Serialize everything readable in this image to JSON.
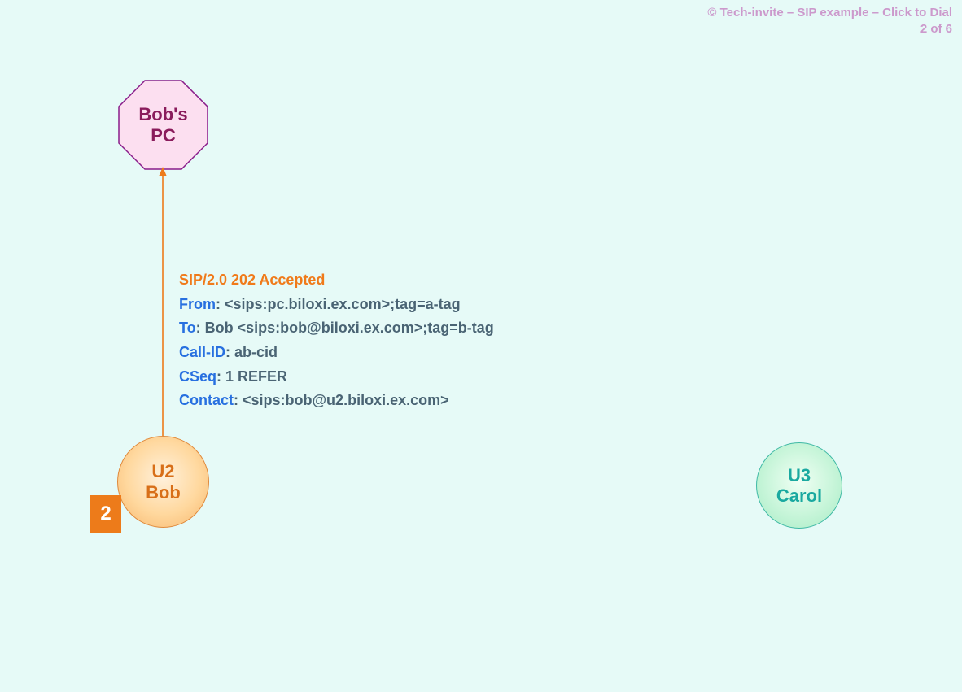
{
  "header": {
    "copyright": "© Tech-invite – SIP example – Click to Dial",
    "page_indicator": "2 of 6"
  },
  "nodes": {
    "pc": {
      "label": "Bob's\nPC"
    },
    "bob": {
      "label": "U2\nBob"
    },
    "carol": {
      "label": "U3\nCarol"
    }
  },
  "step": {
    "number": "2"
  },
  "message": {
    "status_line": "SIP/2.0 202 Accepted",
    "headers": {
      "from": {
        "name": "From",
        "value": " <sips:pc.biloxi.ex.com>;tag=a-tag"
      },
      "to": {
        "name": "To",
        "value": " Bob <sips:bob@biloxi.ex.com>;tag=b-tag"
      },
      "call_id": {
        "name": "Call-ID",
        "value": " ab-cid"
      },
      "cseq": {
        "name": "CSeq",
        "value": " 1 REFER"
      },
      "contact": {
        "name": "Contact",
        "value": " <sips:bob@u2.biloxi.ex.com>"
      }
    }
  }
}
